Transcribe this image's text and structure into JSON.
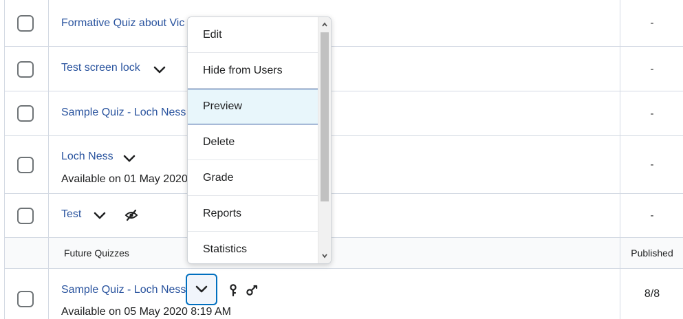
{
  "rows": [
    {
      "title": "Formative Quiz about Vic",
      "published": "-"
    },
    {
      "title": "Test screen lock",
      "published": "-"
    },
    {
      "title": "Sample Quiz - Loch Ness",
      "published": "-"
    },
    {
      "title": "Loch Ness",
      "subtitle": "Available on 01 May 2020",
      "published": "-"
    },
    {
      "title": "Test",
      "published": "-"
    }
  ],
  "group": {
    "label": "Future Quizzes",
    "published_header": "Published"
  },
  "future_row": {
    "title": "Sample Quiz - Loch Ness",
    "subtitle": "Available on 05 May 2020 8:19 AM",
    "published": "8/8"
  },
  "menu": {
    "items": [
      "Edit",
      "Hide from Users",
      "Preview",
      "Delete",
      "Grade",
      "Reports",
      "Statistics"
    ],
    "active_index": 2
  },
  "colors": {
    "link": "#29539e",
    "focus": "#006fbf",
    "active_bg": "#e8f6fb"
  }
}
